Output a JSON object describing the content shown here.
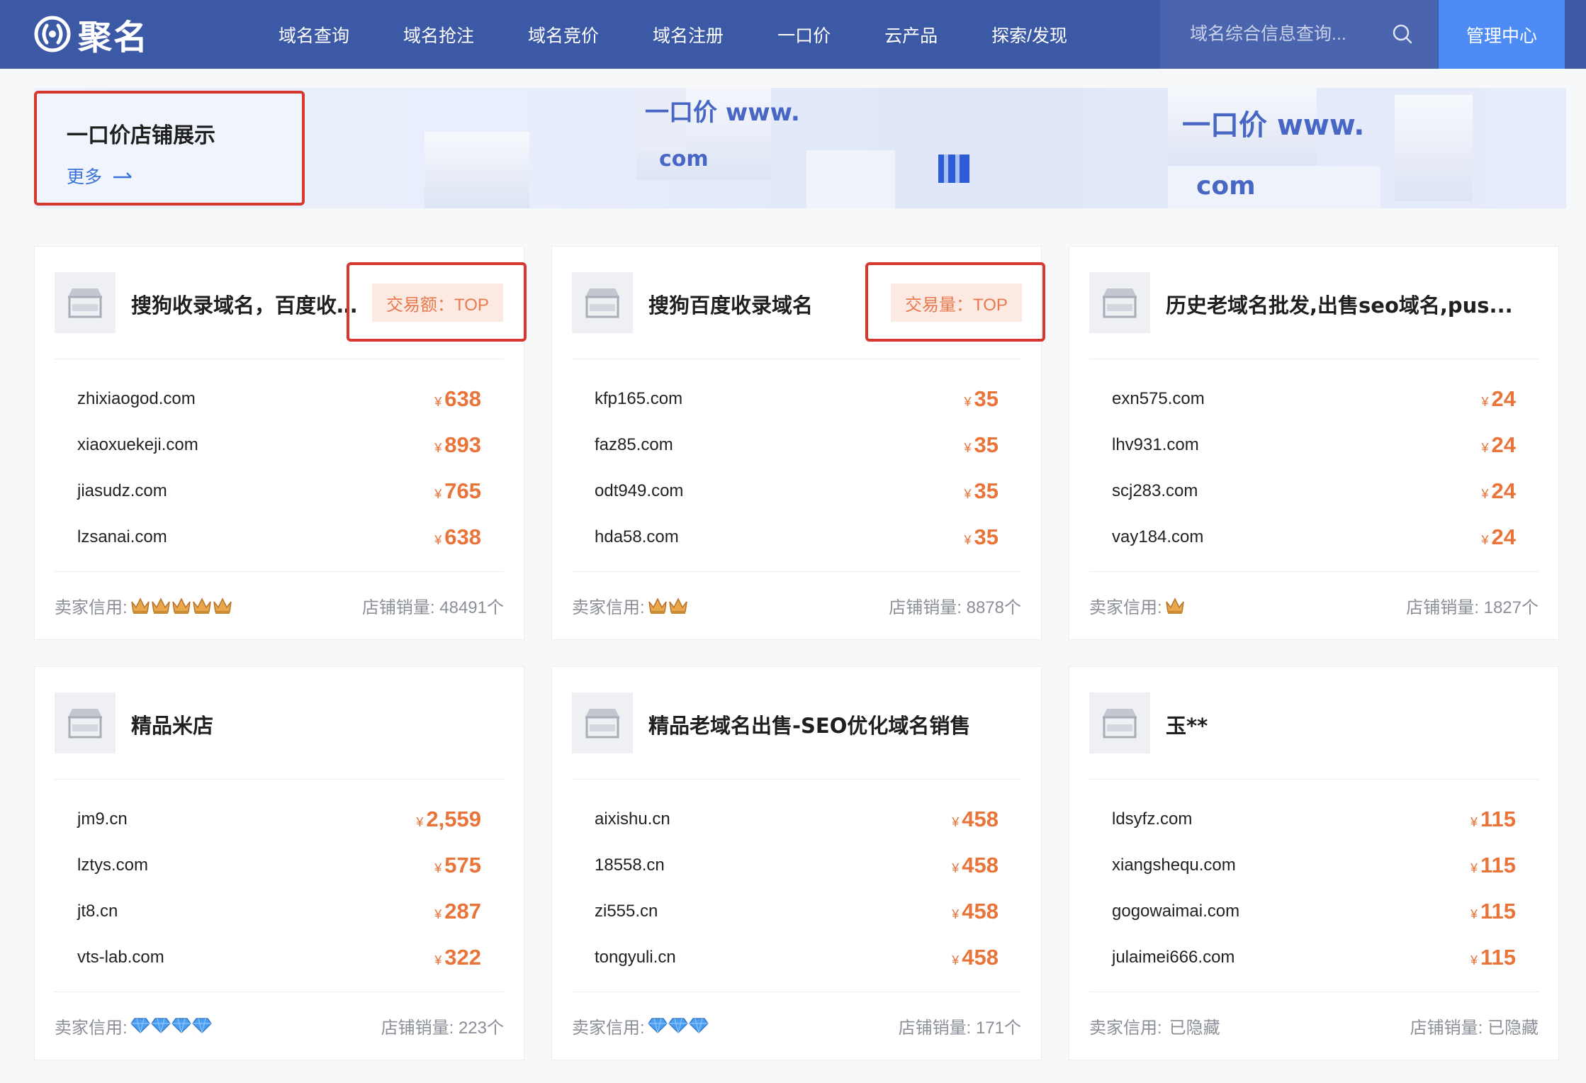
{
  "nav": {
    "brand": "聚名",
    "items": [
      "域名查询",
      "域名抢注",
      "域名竞价",
      "域名注册",
      "一口价",
      "云产品",
      "探索/发现"
    ],
    "search_placeholder": "域名综合信息查询...",
    "manage_label": "管理中心",
    "bg_color": "#3c59a6",
    "accent_color": "#4d8cf5"
  },
  "banner": {
    "title": "一口价店铺展示",
    "more_label": "更多"
  },
  "labels": {
    "credit": "卖家信用:",
    "sales": "店铺销量:"
  },
  "cards": [
    {
      "title": "搜狗收录域名，百度收...",
      "badge": "交易额：TOP",
      "domains": [
        {
          "name": "zhixiaogod.com",
          "price": "638"
        },
        {
          "name": "xiaoxuekeji.com",
          "price": "893"
        },
        {
          "name": "jiasudz.com",
          "price": "765"
        },
        {
          "name": "lzsanai.com",
          "price": "638"
        }
      ],
      "credit_icon": "crown-icon",
      "credit_count": 5,
      "credit_text": "",
      "sales": "48491个"
    },
    {
      "title": "搜狗百度收录域名",
      "badge": "交易量：TOP",
      "domains": [
        {
          "name": "kfp165.com",
          "price": "35"
        },
        {
          "name": "faz85.com",
          "price": "35"
        },
        {
          "name": "odt949.com",
          "price": "35"
        },
        {
          "name": "hda58.com",
          "price": "35"
        }
      ],
      "credit_icon": "crown-icon",
      "credit_count": 2,
      "credit_text": "",
      "sales": "8878个"
    },
    {
      "title": "历史老域名批发,出售seo域名,pus...",
      "badge": "",
      "domains": [
        {
          "name": "exn575.com",
          "price": "24"
        },
        {
          "name": "lhv931.com",
          "price": "24"
        },
        {
          "name": "scj283.com",
          "price": "24"
        },
        {
          "name": "vay184.com",
          "price": "24"
        }
      ],
      "credit_icon": "crown-icon",
      "credit_count": 1,
      "credit_text": "",
      "sales": "1827个"
    },
    {
      "title": "精品米店",
      "badge": "",
      "domains": [
        {
          "name": "jm9.cn",
          "price": "2,559"
        },
        {
          "name": "lztys.com",
          "price": "575"
        },
        {
          "name": "jt8.cn",
          "price": "287"
        },
        {
          "name": "vts-lab.com",
          "price": "322"
        }
      ],
      "credit_icon": "diamond-icon",
      "credit_count": 4,
      "credit_text": "",
      "sales": "223个"
    },
    {
      "title": "精品老域名出售-SEO优化域名销售",
      "badge": "",
      "domains": [
        {
          "name": "aixishu.cn",
          "price": "458"
        },
        {
          "name": "18558.cn",
          "price": "458"
        },
        {
          "name": "zi555.cn",
          "price": "458"
        },
        {
          "name": "tongyuli.cn",
          "price": "458"
        }
      ],
      "credit_icon": "diamond-icon",
      "credit_count": 3,
      "credit_text": "",
      "sales": "171个"
    },
    {
      "title": "玉**",
      "badge": "",
      "domains": [
        {
          "name": "ldsyfz.com",
          "price": "115"
        },
        {
          "name": "xiangshequ.com",
          "price": "115"
        },
        {
          "name": "gogowaimai.com",
          "price": "115"
        },
        {
          "name": "julaimei666.com",
          "price": "115"
        }
      ],
      "credit_icon": "",
      "credit_count": 0,
      "credit_text": "已隐藏",
      "sales": "已隐藏"
    }
  ],
  "price_currency": "¥",
  "price_color": "#e8743a"
}
